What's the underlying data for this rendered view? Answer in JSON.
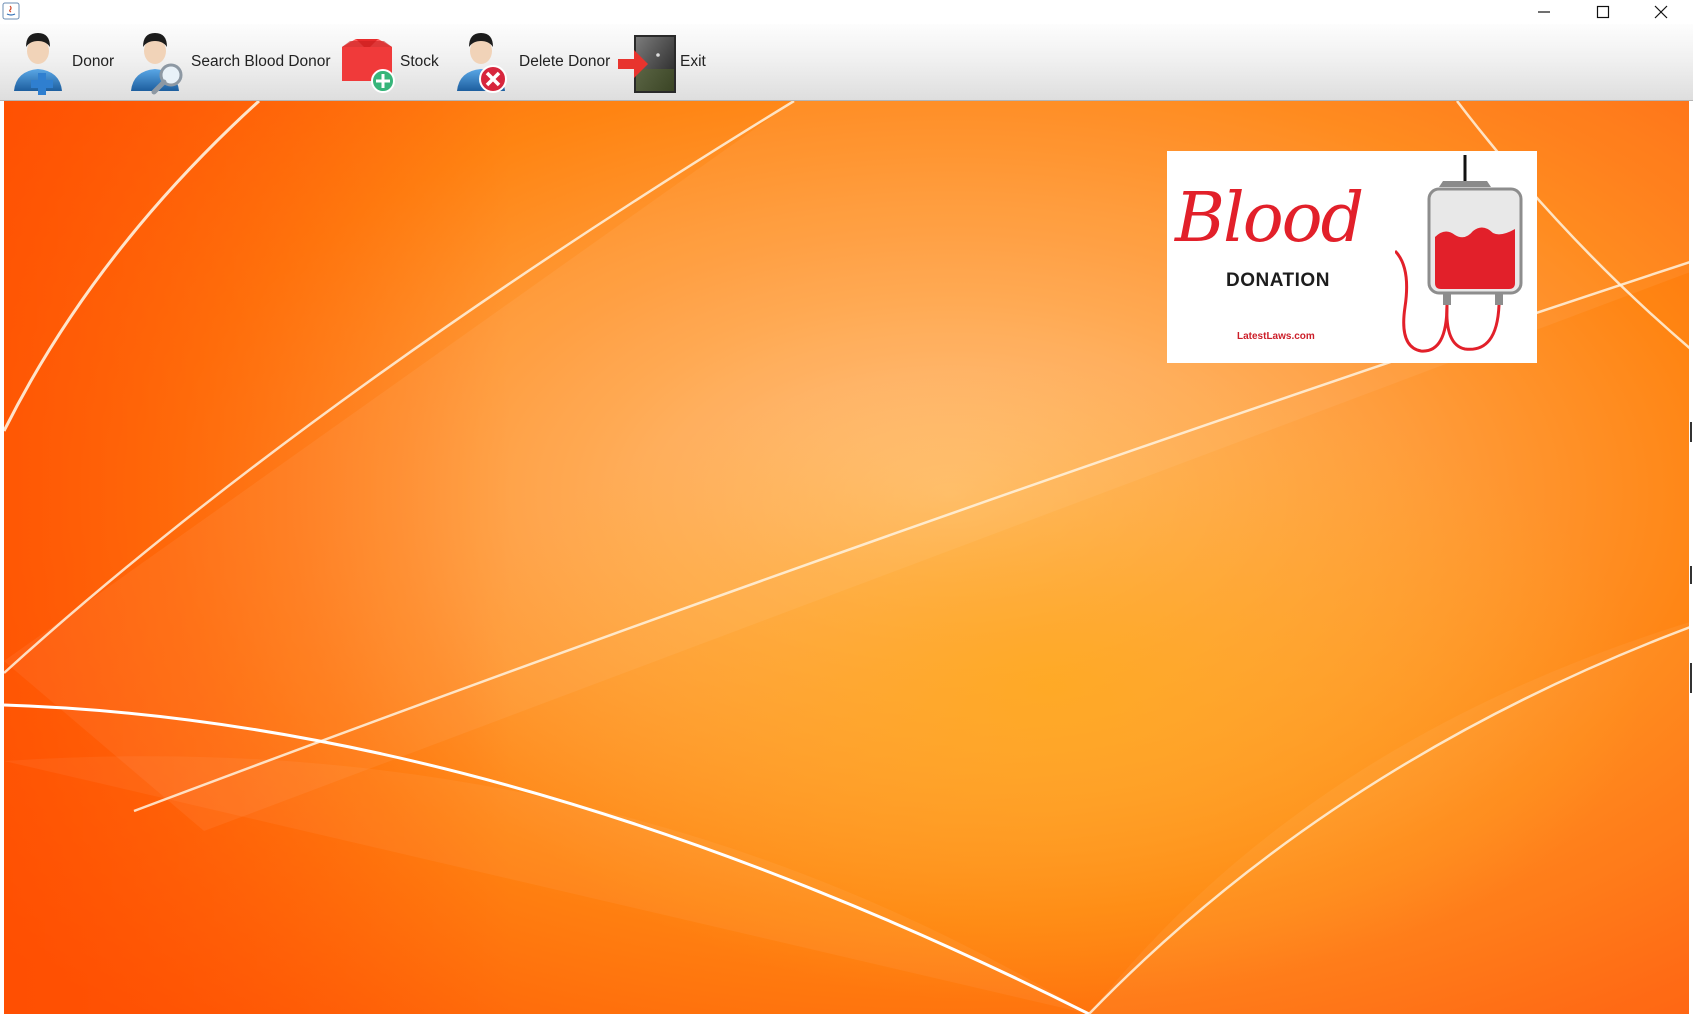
{
  "window": {
    "title": "",
    "controls": {
      "minimize_icon": "minimize-icon",
      "maximize_icon": "maximize-icon",
      "close_icon": "close-icon"
    }
  },
  "toolbar": {
    "buttons": [
      {
        "label": "Donor",
        "icon": "add-donor-icon"
      },
      {
        "label": "Search Blood Donor",
        "icon": "search-donor-icon"
      },
      {
        "label": "Stock",
        "icon": "stock-icon"
      },
      {
        "label": "Delete Donor",
        "icon": "delete-donor-icon"
      },
      {
        "label": "Exit",
        "icon": "exit-door-icon"
      }
    ]
  },
  "logo": {
    "word": "Blood",
    "subtitle": "DONATION",
    "site": "LatestLaws.com"
  },
  "colors": {
    "background_main": "#ff7b00",
    "background_highlight": "#ffc078",
    "logo_red": "#e2202a",
    "toolbar_top": "#fdfdfd",
    "toolbar_bottom": "#dedede"
  }
}
